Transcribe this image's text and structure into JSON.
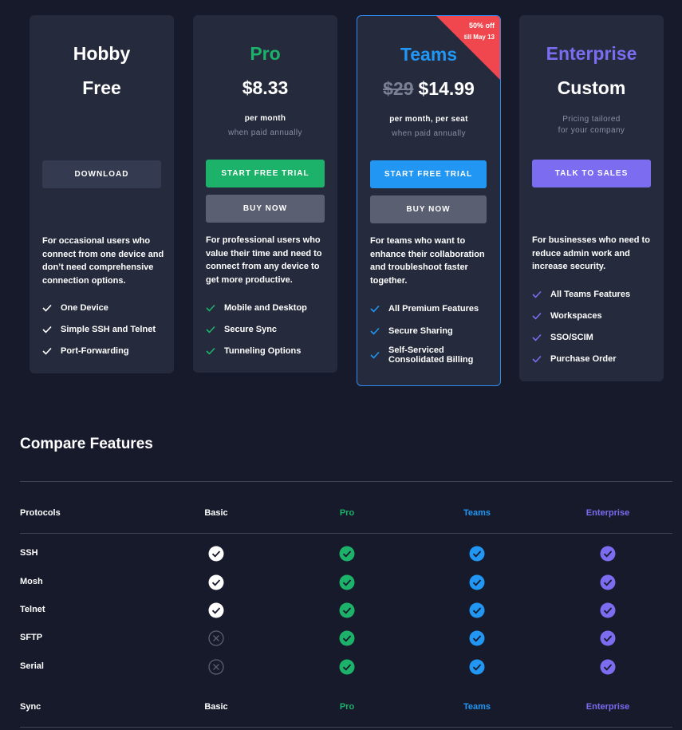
{
  "colors": {
    "background": "#161a2b",
    "card": "#252a3c",
    "pro": "#1db26a",
    "teams": "#2196f3",
    "enterprise": "#7b6cf0",
    "ribbon": "#f0474e"
  },
  "plans": {
    "hobby": {
      "name": "Hobby",
      "price": "Free",
      "button": "DOWNLOAD",
      "description": "For occasional users who connect from one device and don’t need comprehensive connection options.",
      "features": [
        "One Device",
        "Simple SSH and Telnet",
        "Port-Forwarding"
      ]
    },
    "pro": {
      "name": "Pro",
      "price": "$8.33",
      "period": "per month",
      "period_note": "when paid annually",
      "primary_button": "START FREE TRIAL",
      "secondary_button": "BUY NOW",
      "description": "For professional users who value their time and need to connect from any device to get more productive.",
      "features": [
        "Mobile and Desktop",
        "Secure Sync",
        "Tunneling Options"
      ]
    },
    "teams": {
      "name": "Teams",
      "old_price": "$29",
      "price": "$14.99",
      "period": "per month, per seat",
      "period_note": "when paid annually",
      "ribbon_line1": "50% off",
      "ribbon_line2": "till May 13",
      "primary_button": "START FREE TRIAL",
      "secondary_button": "BUY NOW",
      "description": "For teams who want to enhance their collaboration and troubleshoot faster together.",
      "features": [
        "All Premium Features",
        "Secure Sharing",
        "Self-Serviced",
        "Consolidated Billing"
      ]
    },
    "enterprise": {
      "name": "Enterprise",
      "price": "Custom",
      "note_line1": "Pricing tailored",
      "note_line2": "for your company",
      "button": "TALK TO SALES",
      "description": "For businesses who need to reduce admin work and increase security.",
      "features": [
        "All Teams Features",
        "Workspaces",
        "SSO/SCIM",
        "Purchase Order"
      ]
    }
  },
  "compare": {
    "title": "Compare Features",
    "columns": [
      "Basic",
      "Pro",
      "Teams",
      "Enterprise"
    ],
    "protocols_header": "Protocols",
    "protocol_rows": [
      {
        "name": "SSH",
        "basic": true
      },
      {
        "name": "Mosh",
        "basic": true
      },
      {
        "name": "Telnet",
        "basic": true
      },
      {
        "name": "SFTP",
        "basic": false
      },
      {
        "name": "Serial",
        "basic": false
      }
    ],
    "sync_header": "Sync"
  }
}
